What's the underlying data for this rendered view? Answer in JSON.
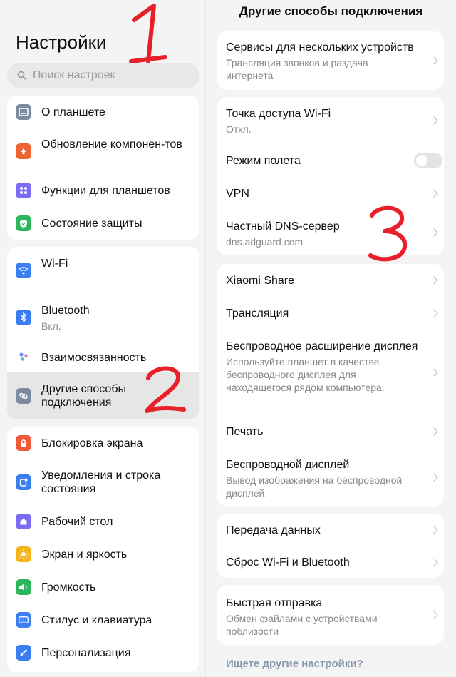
{
  "sidebar": {
    "title": "Настройки",
    "search_placeholder": "Поиск настроек",
    "items": [
      {
        "label": "О планшете",
        "sub": "",
        "icon": "tablet-icon",
        "color": "#7d8b9e"
      },
      {
        "label": "Обновление компонен-тов",
        "sub": "",
        "icon": "update-icon",
        "color": "#f06332"
      },
      {
        "label": "Функции для планшетов",
        "sub": "",
        "icon": "apps-icon",
        "color": "#7b6cf6"
      },
      {
        "label": "Состояние защиты",
        "sub": "",
        "icon": "shield-icon",
        "color": "#2fb55b"
      },
      {
        "label": "Wi-Fi",
        "sub": "",
        "icon": "wifi-icon",
        "color": "#3a7ef0"
      },
      {
        "label": "Bluetooth",
        "sub": "Вкл.",
        "icon": "bluetooth-icon",
        "color": "#3a7ef0"
      },
      {
        "label": "Взаимосвязанность",
        "sub": "",
        "icon": "connectivity-icon",
        "color": "#9c6cf0"
      },
      {
        "label": "Другие способы подключения",
        "sub": "",
        "icon": "link-icon",
        "color": "#7d8b9e"
      },
      {
        "label": "Блокировка экрана",
        "sub": "",
        "icon": "lock-icon",
        "color": "#f05a3a"
      },
      {
        "label": "Уведомления и строка состояния",
        "sub": "",
        "icon": "notification-icon",
        "color": "#3a7ef0"
      },
      {
        "label": "Рабочий стол",
        "sub": "",
        "icon": "home-icon",
        "color": "#7b6cf6"
      },
      {
        "label": "Экран и яркость",
        "sub": "",
        "icon": "brightness-icon",
        "color": "#f5b51a"
      },
      {
        "label": "Громкость",
        "sub": "",
        "icon": "volume-icon",
        "color": "#2fb55b"
      },
      {
        "label": "Стилус и клавиатура",
        "sub": "",
        "icon": "keyboard-icon",
        "color": "#3a7ef0"
      },
      {
        "label": "Персонализация",
        "sub": "",
        "icon": "brush-icon",
        "color": "#3a7ef0"
      }
    ]
  },
  "main": {
    "title": "Другие способы подключения",
    "items": [
      {
        "label": "Сервисы для нескольких устройств",
        "desc": "Трансляция звонков и раздача интернета"
      },
      {
        "label": "Точка доступа Wi-Fi",
        "desc": "Откл."
      },
      {
        "label": "Режим полета",
        "desc": "",
        "toggle": false
      },
      {
        "label": "VPN",
        "desc": ""
      },
      {
        "label": "Частный DNS-сервер",
        "desc": "dns.adguard.com"
      },
      {
        "label": "Xiaomi Share",
        "desc": ""
      },
      {
        "label": "Трансляция",
        "desc": ""
      },
      {
        "label": "Беспроводное расширение дисплея",
        "desc": "Используйте планшет в качестве беспроводного дисплея для находящегося рядом компьютера."
      },
      {
        "label": "Печать",
        "desc": ""
      },
      {
        "label": "Беспроводной дисплей",
        "desc": "Вывод изображения на беспроводной дисплей."
      },
      {
        "label": "Передача данных",
        "desc": ""
      },
      {
        "label": "Сброс Wi-Fi и Bluetooth",
        "desc": ""
      },
      {
        "label": "Быстрая отправка",
        "desc": "Обмен файлами с устройствами поблизости"
      }
    ],
    "more_link": "Ищете другие настройки?"
  },
  "annotations": [
    "1",
    "2",
    "3"
  ],
  "colors": {
    "annotation": "#e8202a",
    "active_row": "#e6e6e6"
  }
}
